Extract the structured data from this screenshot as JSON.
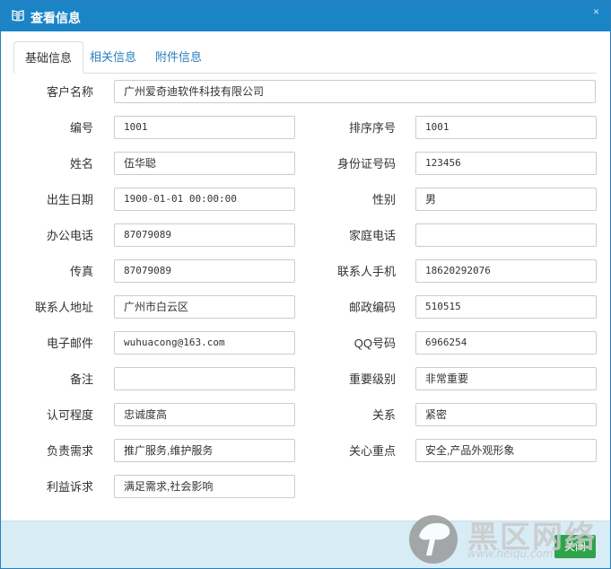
{
  "dialog": {
    "title": "查看信息",
    "close_glyph": "×"
  },
  "tabs": [
    {
      "label": "基础信息",
      "active": true
    },
    {
      "label": "相关信息",
      "active": false
    },
    {
      "label": "附件信息",
      "active": false
    }
  ],
  "form": {
    "customer_name": {
      "label": "客户名称",
      "value": "广州爱奇迪软件科技有限公司"
    },
    "code": {
      "label": "编号",
      "value": "1001"
    },
    "sort_order": {
      "label": "排序序号",
      "value": "1001"
    },
    "name": {
      "label": "姓名",
      "value": "伍华聪"
    },
    "id_number": {
      "label": "身份证号码",
      "value": "123456"
    },
    "birthdate": {
      "label": "出生日期",
      "value": "1900-01-01 00:00:00"
    },
    "gender": {
      "label": "性别",
      "value": "男"
    },
    "office_phone": {
      "label": "办公电话",
      "value": "87079089"
    },
    "home_phone": {
      "label": "家庭电话",
      "value": ""
    },
    "fax": {
      "label": "传真",
      "value": "87079089"
    },
    "mobile": {
      "label": "联系人手机",
      "value": "18620292076"
    },
    "address": {
      "label": "联系人地址",
      "value": "广州市白云区"
    },
    "postcode": {
      "label": "邮政编码",
      "value": "510515"
    },
    "email": {
      "label": "电子邮件",
      "value": "wuhuacong@163.com"
    },
    "qq": {
      "label": "QQ号码",
      "value": "6966254"
    },
    "remark": {
      "label": "备注",
      "value": ""
    },
    "importance": {
      "label": "重要级别",
      "value": "非常重要"
    },
    "recognition": {
      "label": "认可程度",
      "value": "忠诚度高"
    },
    "relation": {
      "label": "关系",
      "value": "紧密"
    },
    "responsible_needs": {
      "label": "负责需求",
      "value": "推广服务,维护服务"
    },
    "focus": {
      "label": "关心重点",
      "value": "安全,产品外观形象"
    },
    "interest": {
      "label": "利益诉求",
      "value": "满足需求,社会影响"
    }
  },
  "footer": {
    "close_label": "关闭"
  },
  "watermark": {
    "text": "黑区网络",
    "url": "www.heiqu.com"
  },
  "colors": {
    "titlebar": "#1b84c7",
    "footer": "#d8ecf6",
    "close_button": "#2fa34a"
  }
}
